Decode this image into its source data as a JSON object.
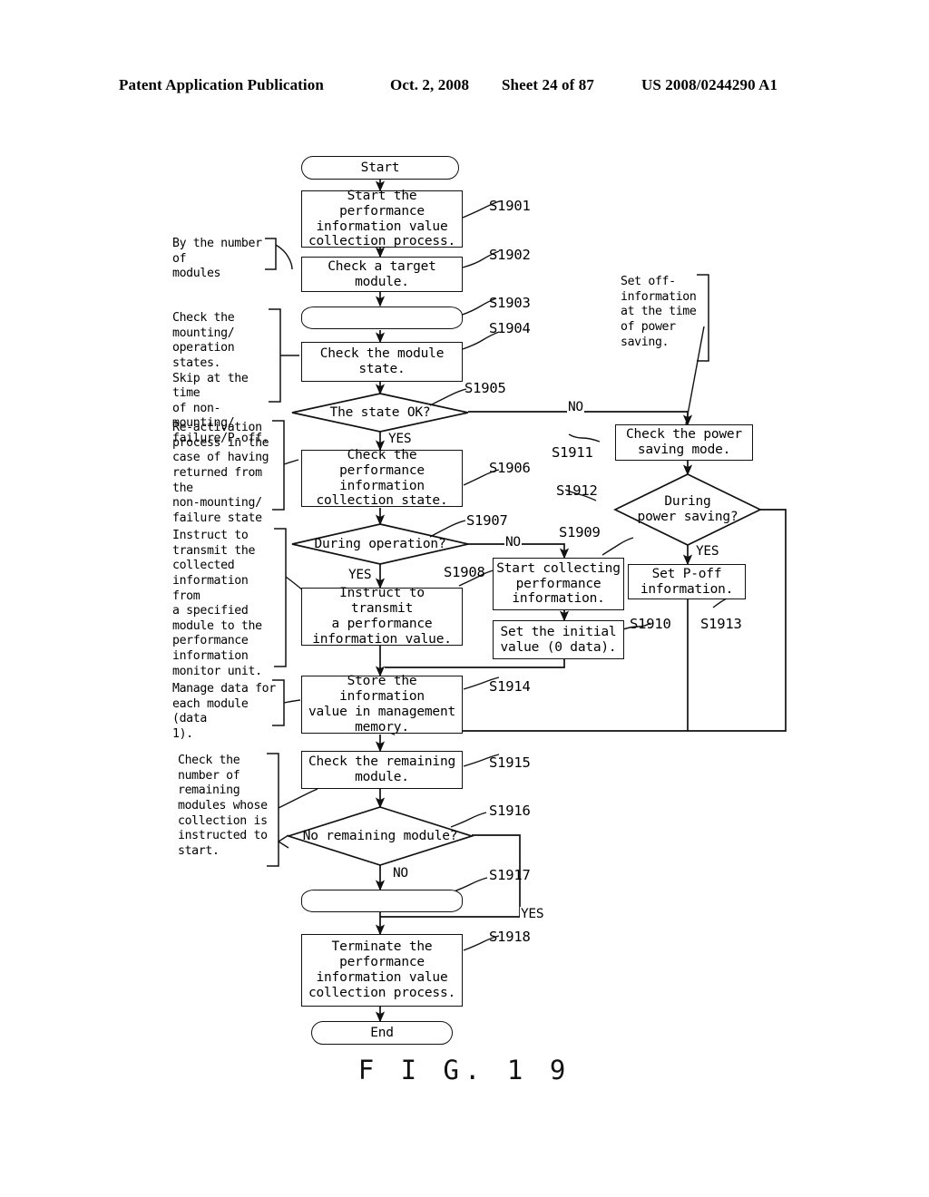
{
  "header": {
    "publication": "Patent Application Publication",
    "date": "Oct. 2, 2008",
    "sheet": "Sheet 24 of 87",
    "patent_number": "US 2008/0244290 A1"
  },
  "figure": {
    "caption": "F I G.  1 9"
  },
  "flowchart": {
    "nodes": {
      "start": {
        "label": "Start",
        "step": ""
      },
      "s1901": {
        "label": "Start the performance\ninformation value\ncollection process.",
        "step": "S1901"
      },
      "s1902": {
        "label": "Check a target\nmodule.",
        "step": "S1902"
      },
      "s1903": {
        "label": "",
        "step": "S1903"
      },
      "s1904": {
        "label": "Check the module\nstate.",
        "step": "S1904"
      },
      "s1905": {
        "label": "The state OK?",
        "step": "S1905"
      },
      "s1906": {
        "label": "Check the performance\ninformation\ncollection state.",
        "step": "S1906"
      },
      "s1907": {
        "label": "During operation?",
        "step": "S1907"
      },
      "s1908": {
        "label": "Instruct to transmit\na performance\ninformation value.",
        "step": "S1908"
      },
      "s1909": {
        "label": "Start collecting\nperformance\ninformation.",
        "step": "S1909"
      },
      "s1910": {
        "label": "Set the initial\nvalue (0 data).",
        "step": "S1910"
      },
      "s1911": {
        "label": "Check the power\nsaving mode.",
        "step": "S1911"
      },
      "s1912": {
        "label": "During\npower saving?",
        "step": "S1912"
      },
      "s1913": {
        "label": "Set P-off\ninformation.",
        "step": "S1913"
      },
      "s1914": {
        "label": "Store the information\nvalue in management\nmemory.",
        "step": "S1914"
      },
      "s1915": {
        "label": "Check the remaining\nmodule.",
        "step": "S1915"
      },
      "s1916": {
        "label": "No remaining module?",
        "step": "S1916"
      },
      "s1917": {
        "label": "",
        "step": "S1917"
      },
      "s1918": {
        "label": "Terminate the\nperformance\ninformation value\ncollection process.",
        "step": "S1918"
      },
      "end": {
        "label": "End",
        "step": ""
      }
    },
    "branch_labels": {
      "s1905_no": "NO",
      "s1905_yes": "YES",
      "s1907_no": "NO",
      "s1907_yes": "YES",
      "s1912_yes": "YES",
      "s1916_no": "NO",
      "s1916_yes": "YES"
    },
    "annotations": {
      "a1": "By the number of\nmodules",
      "a2": "Check the\nmounting/\noperation states.\nSkip at the time\nof non-mounting/\nfailure/P-off.",
      "a3": "Re-activation\nprocess in the\ncase of having\nreturned from the\nnon-mounting/\nfailure state",
      "a4": "Instruct to\ntransmit the\ncollected\ninformation from\na specified\nmodule to the\nperformance\ninformation\nmonitor unit.",
      "a5": "Manage data for\neach module (data\n1).",
      "a6": "Check the\nnumber of\nremaining\nmodules whose\ncollection is\ninstructed to\nstart.",
      "a7": "Set off-\ninformation\nat the time\nof power\nsaving."
    }
  }
}
